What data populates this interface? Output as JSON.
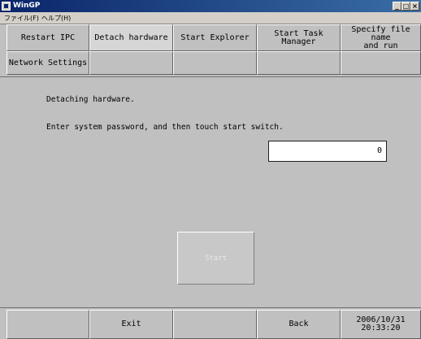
{
  "window": {
    "title": "WinGP",
    "min_glyph": "_",
    "max_glyph": "□",
    "close_glyph": "×"
  },
  "menu": {
    "file": "ファイル(F)",
    "help": "ヘルプ(H)"
  },
  "top_buttons": {
    "restart_ipc": "Restart IPC",
    "detach_hardware": "Detach hardware",
    "start_explorer": "Start Explorer",
    "start_task_manager": "Start Task Manager",
    "specify_file": "Specify file name\nand run",
    "network_settings": "Network Settings"
  },
  "main": {
    "heading": "Detaching hardware.",
    "instruction": "Enter system password, and then touch start switch.",
    "password_value": "0",
    "start_label": "Start"
  },
  "footer": {
    "exit": "Exit",
    "back": "Back",
    "date": "2006/10/31",
    "time": "20:33:20"
  },
  "colors": {
    "title_bar": "#0a246a",
    "panel_bg": "#c0c0c0",
    "active_tab_bg": "#d6d6d6",
    "disabled_text": "#e8e8e8"
  }
}
